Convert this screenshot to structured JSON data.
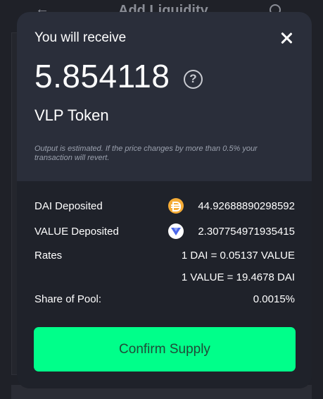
{
  "background": {
    "back_icon": "←",
    "title": "Add Liquidity",
    "help_icon": "help-circle-icon"
  },
  "modal": {
    "title": "You will receive",
    "close_icon": "close-icon",
    "amount": "5.854118",
    "help_glyph": "?",
    "token_name": "VLP Token",
    "note": "Output is estimated. If the price changes by more than 0.5% your transaction will revert.",
    "rows": {
      "dai_label": "DAI Deposited",
      "dai_value": "44.92688890298592",
      "value_label": "VALUE Deposited",
      "value_value": "2.307754971935415",
      "rates_label": "Rates",
      "rate_1": "1 DAI = 0.05137 VALUE",
      "rate_2": "1 VALUE = 19.4678 DAI",
      "share_label": "Share of Pool:",
      "share_value": "0.0015%"
    },
    "confirm_label": "Confirm Supply"
  },
  "colors": {
    "modal_top": "#2a2e3a",
    "modal_bottom": "#1f222a",
    "accent": "#00ff8a",
    "dai_coin": "#f5ac37",
    "value_coin": "#4b66e8"
  }
}
